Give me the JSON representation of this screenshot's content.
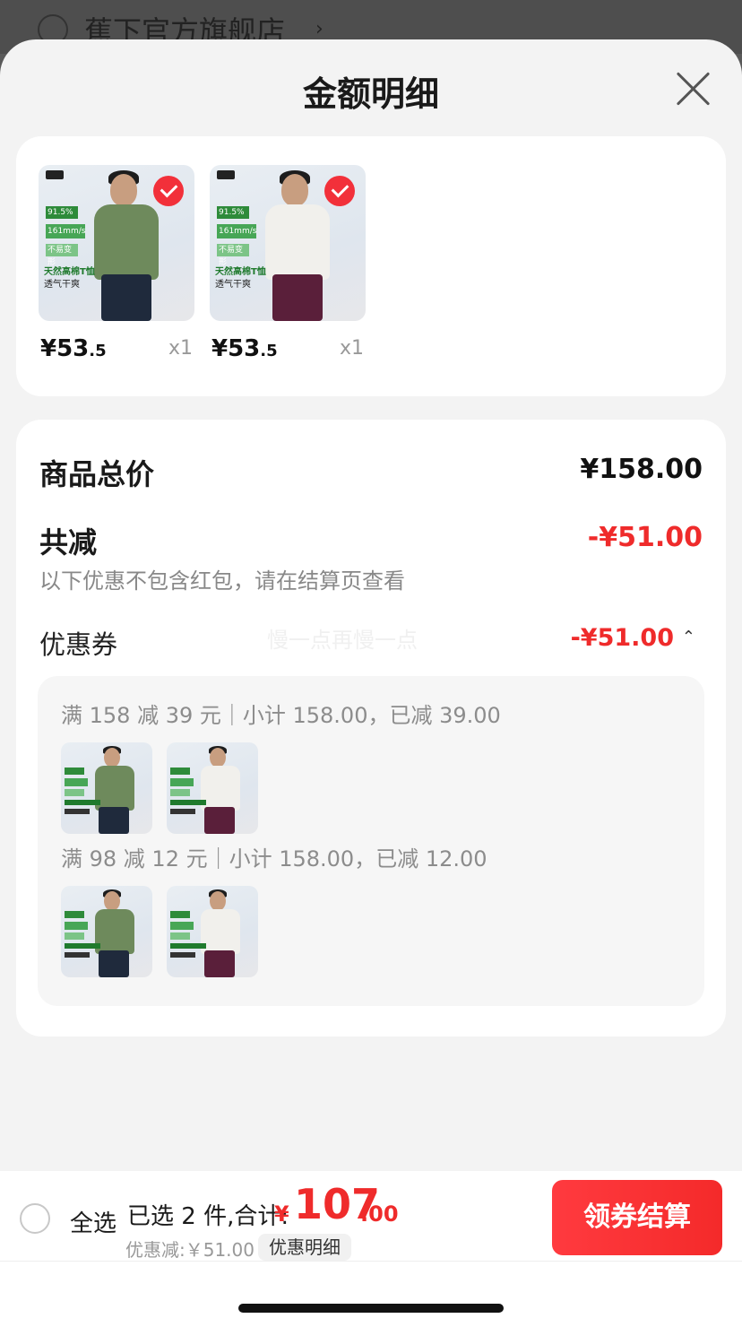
{
  "background_store": {
    "name": "蕉下官方旗舰店",
    "chevron": "›"
  },
  "sheet": {
    "title": "金额明细"
  },
  "items": [
    {
      "price_int": "¥53",
      "price_dec": ".5",
      "qty": "x1",
      "shirt_color": "#6e8a5c",
      "pants_color": "#1f2a3c",
      "tag1": "91.5%",
      "tag2": "161mm/s",
      "tag3": "不易变形",
      "line1": "天然高棉T恤",
      "line2": "透气干爽",
      "checked": true
    },
    {
      "price_int": "¥53",
      "price_dec": ".5",
      "qty": "x1",
      "shirt_color": "#f1f0ec",
      "pants_color": "#5a1f3a",
      "tag1": "91.5%",
      "tag2": "161mm/s",
      "tag3": "不易变形",
      "line1": "天然高棉T恤",
      "line2": "透气干爽",
      "checked": true
    }
  ],
  "summary": {
    "total_label": "商品总价",
    "total_value": "¥158.00",
    "reduce_label": "共减",
    "reduce_value": "-¥51.00",
    "note": "以下优惠不包含红包，请在结算页查看",
    "coupon_label": "优惠券",
    "watermark": "慢一点再慢一点",
    "coupon_value": "-¥51.00",
    "coupon_caret": "⌃"
  },
  "coupon_rules": [
    {
      "text": "满 158 减 39 元｜小计 158.00，已减 39.00"
    },
    {
      "text": "满 98 减 12 元｜小计 158.00，已减 12.00"
    }
  ],
  "colors": {
    "accent": "#ef2b2b",
    "checkout_start": "#ff3a3f",
    "checkout_end": "#f42a2a"
  },
  "bottom_bar": {
    "select_all": "全选",
    "selected": "已选 2 件,合计:",
    "total_yen": "¥",
    "total_int": "107",
    "total_dec": ".00",
    "discount": "优惠减:￥51.00",
    "detail": "优惠明细",
    "checkout": "领券结算"
  }
}
